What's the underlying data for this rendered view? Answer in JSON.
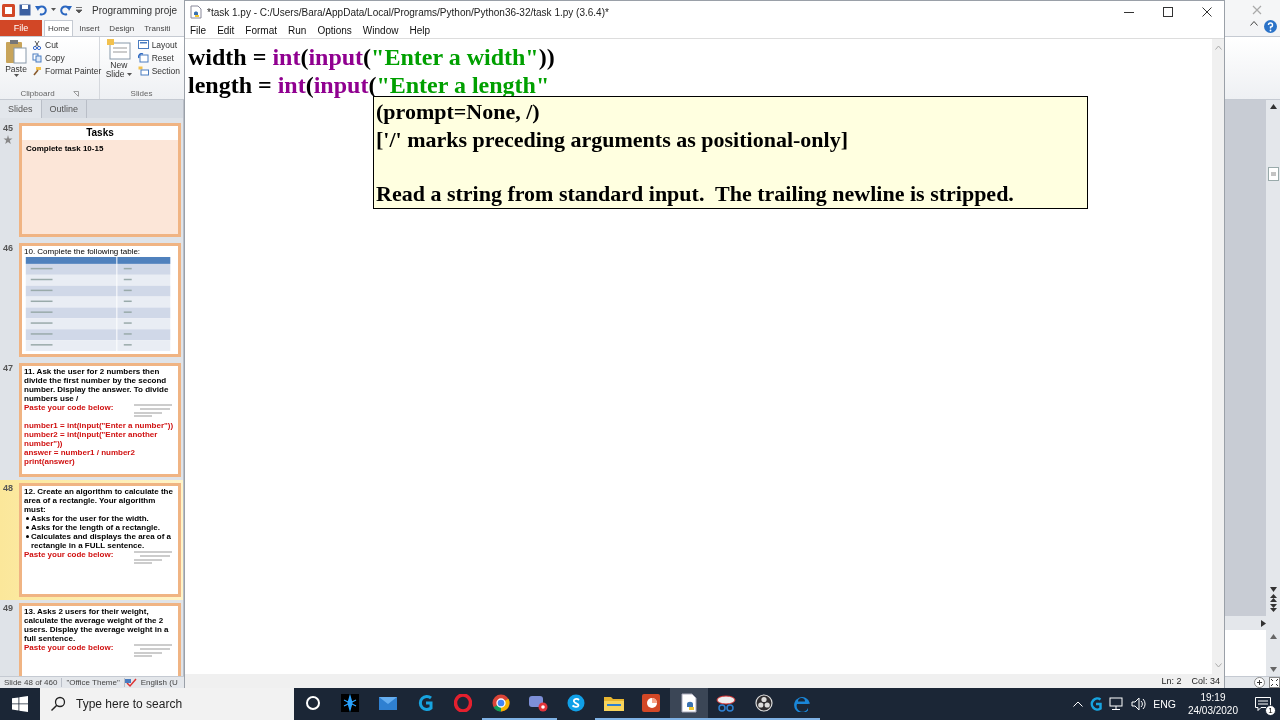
{
  "powerpoint": {
    "title": "Programming proje",
    "file_tab": "File",
    "tabs": [
      {
        "label": "Home",
        "selected": true
      },
      {
        "label": "Insert",
        "selected": false
      },
      {
        "label": "Design",
        "selected": false
      },
      {
        "label": "Transiti",
        "selected": false
      }
    ],
    "clipboard": {
      "paste": "Paste",
      "items": [
        {
          "kind": "cut",
          "label": "Cut"
        },
        {
          "kind": "copy",
          "label": "Copy"
        },
        {
          "kind": "painter",
          "label": "Format Painter"
        }
      ],
      "group_label": "Clipboard"
    },
    "slides_group": {
      "new_slide": [
        "New",
        "Slide"
      ],
      "items": [
        {
          "kind": "layout",
          "label": "Layout"
        },
        {
          "kind": "reset",
          "label": "Reset"
        },
        {
          "kind": "section",
          "label": "Section"
        }
      ],
      "group_label": "Slides"
    },
    "pane_tabs": [
      {
        "label": "Slides",
        "selected": true
      },
      {
        "label": "Outline",
        "selected": false
      }
    ],
    "thumbnails": [
      {
        "number": "45",
        "selected": false,
        "animated": true,
        "kind": "title",
        "title": "Tasks",
        "body": "Complete  task 10-15"
      },
      {
        "number": "46",
        "selected": false,
        "animated": false,
        "kind": "table",
        "title": "10. Complete the following table:"
      },
      {
        "number": "47",
        "selected": false,
        "animated": false,
        "kind": "question",
        "question": "11. Ask the user for 2 numbers then divide the first number by the second number. Display the answer. To divide numbers use /",
        "prompt": "Paste your code below:",
        "answer": [
          "number1 = int(input(\"Enter a number\"))",
          "number2 = int(input(\"Enter another number\"))",
          "answer = number1 / number2",
          "print(answer)"
        ]
      },
      {
        "number": "48",
        "selected": true,
        "animated": false,
        "kind": "question",
        "question": "12. Create an algorithm to calculate the area of a rectangle. Your algorithm must:",
        "prompt": "Paste your code below:",
        "bullets": [
          "Asks for the user for the width.",
          "Asks for the length of a rectangle.",
          "Calculates and displays the area of a rectangle in a FULL sentence."
        ]
      },
      {
        "number": "49",
        "selected": false,
        "animated": false,
        "kind": "question",
        "question": "13. Asks 2 users for their weight, calculate the average weight of the 2 users. Display the average weight in a full sentence.",
        "prompt": "Paste your code below:"
      }
    ],
    "status": [
      "Slide 48 of 460",
      "\"Office Theme\"",
      "English (U"
    ]
  },
  "idle": {
    "title": "*task 1.py - C:/Users/Bara/AppData/Local/Programs/Python/Python36-32/task 1.py (3.6.4)*",
    "menu": [
      "File",
      "Edit",
      "Format",
      "Run",
      "Options",
      "Window",
      "Help"
    ],
    "code": [
      [
        {
          "text": "width = ",
          "kind": "plain"
        },
        {
          "text": "int",
          "kind": "builtin"
        },
        {
          "text": "(",
          "kind": "plain"
        },
        {
          "text": "input",
          "kind": "builtin"
        },
        {
          "text": "(",
          "kind": "plain"
        },
        {
          "text": "\"Enter a width\"",
          "kind": "string"
        },
        {
          "text": "))",
          "kind": "plain"
        }
      ],
      [
        {
          "text": "length = ",
          "kind": "plain"
        },
        {
          "text": "int",
          "kind": "builtin"
        },
        {
          "text": "(",
          "kind": "plain"
        },
        {
          "text": "input",
          "kind": "builtin"
        },
        {
          "text": "(",
          "kind": "plain"
        },
        {
          "text": "\"Enter a length\"",
          "kind": "string"
        }
      ]
    ],
    "calltip": {
      "signature": "(prompt=None, /)",
      "note": "['/' marks preceding arguments as positional-only]",
      "doc": "Read a string from standard input.  The trailing newline is stripped."
    },
    "status": {
      "line": "Ln: 2",
      "column": "Col: 34"
    }
  },
  "taskbar": {
    "search": {
      "placeholder": "Type here to search"
    },
    "apps": [
      {
        "kind": "cortana",
        "running": false,
        "selected": false
      },
      {
        "kind": "launcher",
        "running": false,
        "selected": false
      },
      {
        "kind": "mail",
        "running": false,
        "selected": false
      },
      {
        "kind": "g",
        "running": false,
        "selected": false
      },
      {
        "kind": "opera",
        "running": false,
        "selected": false
      },
      {
        "kind": "chrome",
        "running": true,
        "selected": false
      },
      {
        "kind": "discord",
        "running": true,
        "selected": false
      },
      {
        "kind": "skype",
        "running": false,
        "selected": false
      },
      {
        "kind": "files",
        "running": true,
        "selected": false
      },
      {
        "kind": "powerpoint",
        "running": true,
        "selected": false
      },
      {
        "kind": "idle",
        "running": true,
        "selected": true
      },
      {
        "kind": "snip",
        "running": true,
        "selected": false
      },
      {
        "kind": "obs",
        "running": true,
        "selected": false
      },
      {
        "kind": "edge",
        "running": true,
        "selected": false
      }
    ],
    "language": "ENG",
    "time": "19:19",
    "date": "24/03/2020",
    "notifications": "1"
  }
}
